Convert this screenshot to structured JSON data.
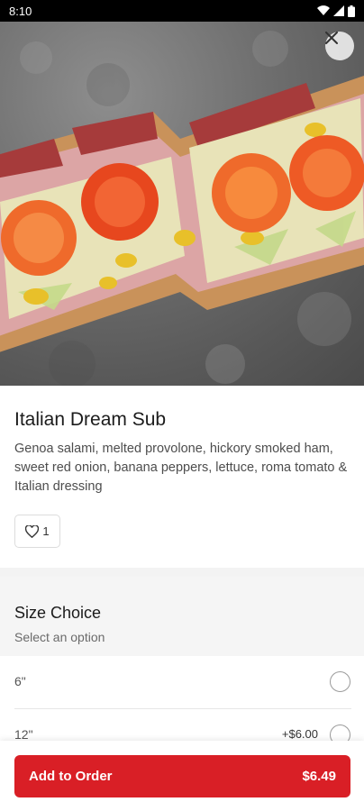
{
  "status_bar": {
    "time": "8:10",
    "icons": [
      "wifi-icon",
      "signal-icon",
      "battery-icon"
    ]
  },
  "hero": {
    "image_alt": "Italian Dream Sub sandwich photo",
    "close_icon": "close-icon"
  },
  "item": {
    "title": "Italian Dream Sub",
    "description": "Genoa salami, melted provolone, hickory smoked ham, sweet red onion, banana peppers, lettuce, roma tomato & Italian dressing",
    "like_count": "1"
  },
  "size_choice": {
    "heading": "Size Choice",
    "subheading": "Select an option",
    "options": [
      {
        "label": "6\"",
        "price": ""
      },
      {
        "label": "12\"",
        "price": "+$6.00"
      }
    ]
  },
  "footer": {
    "add_label": "Add to Order",
    "total": "$6.49"
  },
  "colors": {
    "accent": "#d91f26",
    "background": "#ffffff",
    "section_bg": "#f5f5f5"
  }
}
